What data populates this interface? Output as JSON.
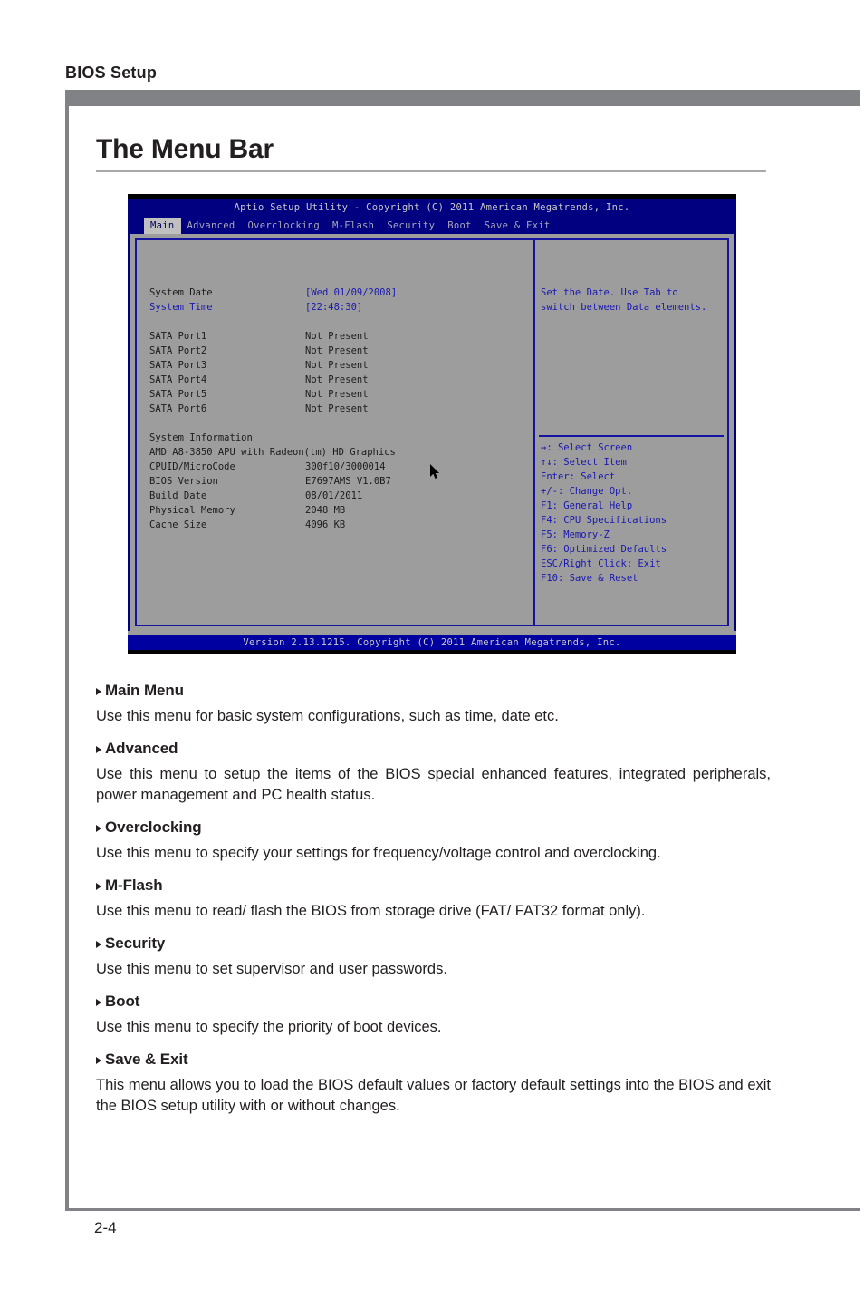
{
  "page": {
    "running_header": "BIOS Setup",
    "section_title": "The Menu Bar",
    "page_number": "2-4"
  },
  "bios": {
    "title": "Aptio Setup Utility - Copyright (C) 2011 American Megatrends, Inc.",
    "menu_items": [
      {
        "label": "Main",
        "active": true
      },
      {
        "label": "Advanced",
        "active": false
      },
      {
        "label": "Overclocking",
        "active": false
      },
      {
        "label": "M-Flash",
        "active": false
      },
      {
        "label": "Security",
        "active": false
      },
      {
        "label": "Boot",
        "active": false
      },
      {
        "label": "Save & Exit",
        "active": false
      }
    ],
    "rows": [
      {
        "key": "System Date",
        "value": "[Wed 01/09/2008]",
        "style": "val-blue"
      },
      {
        "key": "System Time",
        "value": "[22:48:30]",
        "style": "sel"
      },
      {
        "key": "",
        "value": "",
        "style": "spacer"
      },
      {
        "key": "SATA Port1",
        "value": "Not Present",
        "style": ""
      },
      {
        "key": "SATA Port2",
        "value": "Not Present",
        "style": ""
      },
      {
        "key": "SATA Port3",
        "value": "Not Present",
        "style": ""
      },
      {
        "key": "SATA Port4",
        "value": "Not Present",
        "style": ""
      },
      {
        "key": "SATA Port5",
        "value": "Not Present",
        "style": ""
      },
      {
        "key": "SATA Port6",
        "value": "Not Present",
        "style": ""
      },
      {
        "key": "",
        "value": "",
        "style": "spacer"
      },
      {
        "key": "System Information",
        "value": "",
        "style": ""
      },
      {
        "key": "AMD A8-3850 APU with Radeon(tm) HD Graphics",
        "value": "",
        "style": "full"
      },
      {
        "key": "CPUID/MicroCode",
        "value": "300f10/3000014",
        "style": ""
      },
      {
        "key": "BIOS Version",
        "value": "E7697AMS V1.0B7",
        "style": ""
      },
      {
        "key": "Build Date",
        "value": "08/01/2011",
        "style": ""
      },
      {
        "key": "Physical Memory",
        "value": "2048 MB",
        "style": ""
      },
      {
        "key": "Cache Size",
        "value": "4096 KB",
        "style": ""
      }
    ],
    "help_top": [
      "Set the Date. Use Tab to",
      "switch between Data elements."
    ],
    "help_keys": [
      "↔: Select Screen",
      "↑↓: Select Item",
      "Enter: Select",
      "+/-: Change Opt.",
      "F1: General Help",
      "F4: CPU Specifications",
      "F5: Memory-Z",
      "F6: Optimized Defaults",
      "ESC/Right Click: Exit",
      "F10: Save & Reset"
    ],
    "footer": "Version 2.13.1215. Copyright (C) 2011 American Megatrends, Inc."
  },
  "entries": [
    {
      "heading": "Main Menu",
      "body": "Use this menu for basic system configurations, such as time, date etc."
    },
    {
      "heading": "Advanced",
      "body": "Use this menu to setup the items of the BIOS special enhanced features, integrated peripherals, power management and PC health status."
    },
    {
      "heading": "Overclocking",
      "body": "Use this menu to specify your settings for frequency/voltage control and overclocking."
    },
    {
      "heading": "M-Flash",
      "body": "Use this menu to read/ flash the BIOS from storage drive (FAT/ FAT32 format only)."
    },
    {
      "heading": "Security",
      "body": "Use this menu to set supervisor and user passwords."
    },
    {
      "heading": "Boot",
      "body": "Use this menu to specify the priority of boot devices."
    },
    {
      "heading": "Save & Exit",
      "body": "This menu allows you to load the BIOS default values or factory default settings into the BIOS and exit the BIOS setup utility with or without changes."
    }
  ]
}
